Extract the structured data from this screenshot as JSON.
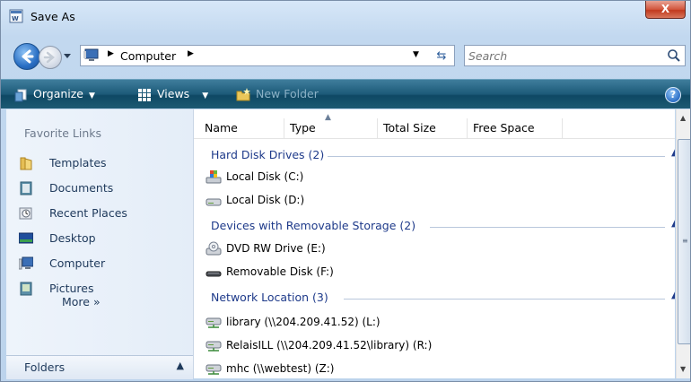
{
  "title_bar": {
    "title": "Save As",
    "close_label": "X"
  },
  "address_bar": {
    "path": "Computer",
    "search_placeholder": "Search"
  },
  "toolbar": {
    "organize": "Organize",
    "views": "Views",
    "new_folder": "New Folder"
  },
  "left_nav": {
    "heading": "Favorite Links",
    "links": [
      {
        "label": "Templates",
        "icon": "folder-icon"
      },
      {
        "label": "Documents",
        "icon": "documents-icon"
      },
      {
        "label": "Recent Places",
        "icon": "recent-places-icon"
      },
      {
        "label": "Desktop",
        "icon": "desktop-icon"
      },
      {
        "label": "Computer",
        "icon": "computer-icon"
      },
      {
        "label": "Pictures",
        "icon": "pictures-icon"
      }
    ],
    "more": "More »",
    "folders": "Folders"
  },
  "columns": [
    "Name",
    "Type",
    "Total Size",
    "Free Space"
  ],
  "groups": [
    {
      "header": "Hard Disk Drives (2)",
      "items": [
        {
          "label": "Local Disk (C:)",
          "icon": "system-drive-icon"
        },
        {
          "label": "Local Disk (D:)",
          "icon": "hard-drive-icon"
        }
      ]
    },
    {
      "header": "Devices with Removable Storage (2)",
      "items": [
        {
          "label": "DVD RW Drive (E:)",
          "icon": "dvd-drive-icon"
        },
        {
          "label": "Removable Disk (F:)",
          "icon": "removable-disk-icon"
        }
      ]
    },
    {
      "header": "Network Location (3)",
      "items": [
        {
          "label": "library (\\\\204.209.41.52) (L:)",
          "icon": "network-drive-icon"
        },
        {
          "label": "RelaisILL (\\\\204.209.41.52\\library) (R:)",
          "icon": "network-drive-icon"
        },
        {
          "label": "mhc (\\\\webtest) (Z:)",
          "icon": "network-drive-icon"
        }
      ]
    }
  ],
  "colors": {
    "toolbar": "#1c5a78",
    "link": "#1e395b",
    "group_header": "#1e3a8a"
  }
}
